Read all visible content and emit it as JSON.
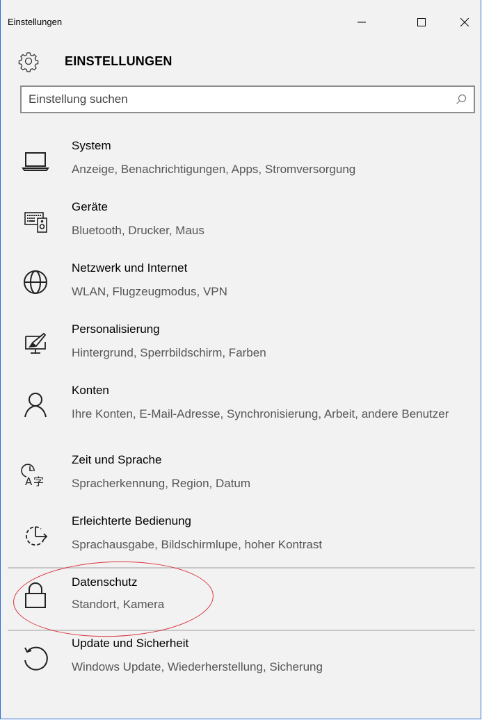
{
  "window": {
    "title": "Einstellungen",
    "controls": {
      "minimize": "—",
      "maximize": "☐",
      "close": "✕"
    }
  },
  "header": {
    "icon": "gear-icon",
    "title": "EINSTELLUNGEN"
  },
  "search": {
    "placeholder": "Einstellung suchen",
    "icon": "search-icon"
  },
  "items": [
    {
      "name": "System",
      "desc": "Anzeige, Benachrichtigungen, Apps, Stromversorgung",
      "icon": "laptop-icon"
    },
    {
      "name": "Geräte",
      "desc": "Bluetooth, Drucker, Maus",
      "icon": "devices-icon"
    },
    {
      "name": "Netzwerk und Internet",
      "desc": "WLAN, Flugzeugmodus, VPN",
      "icon": "globe-icon"
    },
    {
      "name": "Personalisierung",
      "desc": "Hintergrund, Sperrbildschirm, Farben",
      "icon": "paintbrush-icon"
    },
    {
      "name": "Konten",
      "desc": "Ihre Konten, E-Mail-Adresse, Synchronisierung, Arbeit, andere Benutzer",
      "icon": "person-icon"
    },
    {
      "name": "Zeit und Sprache",
      "desc": "Spracherkennung, Region, Datum",
      "icon": "time-language-icon"
    },
    {
      "name": "Erleichterte Bedienung",
      "desc": "Sprachausgabe, Bildschirmlupe, hoher Kontrast",
      "icon": "ease-of-access-icon"
    },
    {
      "name": "Datenschutz",
      "desc": "Standort, Kamera",
      "icon": "lock-icon"
    },
    {
      "name": "Update und Sicherheit",
      "desc": "Windows Update, Wiederherstellung, Sicherung",
      "icon": "update-icon"
    }
  ],
  "annotation": {
    "color": "#d9323b",
    "target": "Datenschutz"
  },
  "colors": {
    "background": "#f2f2f2",
    "window_border": "#2b6dd6",
    "text": "#000000",
    "secondary_text": "#555555"
  }
}
